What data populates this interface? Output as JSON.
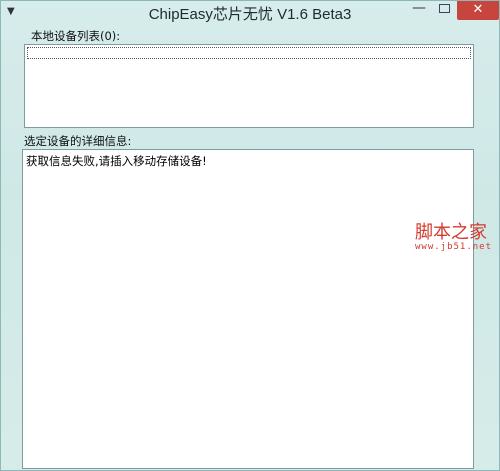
{
  "window": {
    "title": "ChipEasy芯片无忧 V1.6 Beta3",
    "controls": {
      "minimize": "—",
      "close": "✕"
    }
  },
  "device_list": {
    "label": "本地设备列表(0):",
    "items": []
  },
  "details": {
    "label": "选定设备的详细信息:",
    "text": "获取信息失败,请插入移动存储设备!"
  },
  "watermark": {
    "main": "脚本之家",
    "sub": "www.jb51.net"
  },
  "colors": {
    "close_button": "#c7453d",
    "watermark": "#d43a2f"
  }
}
